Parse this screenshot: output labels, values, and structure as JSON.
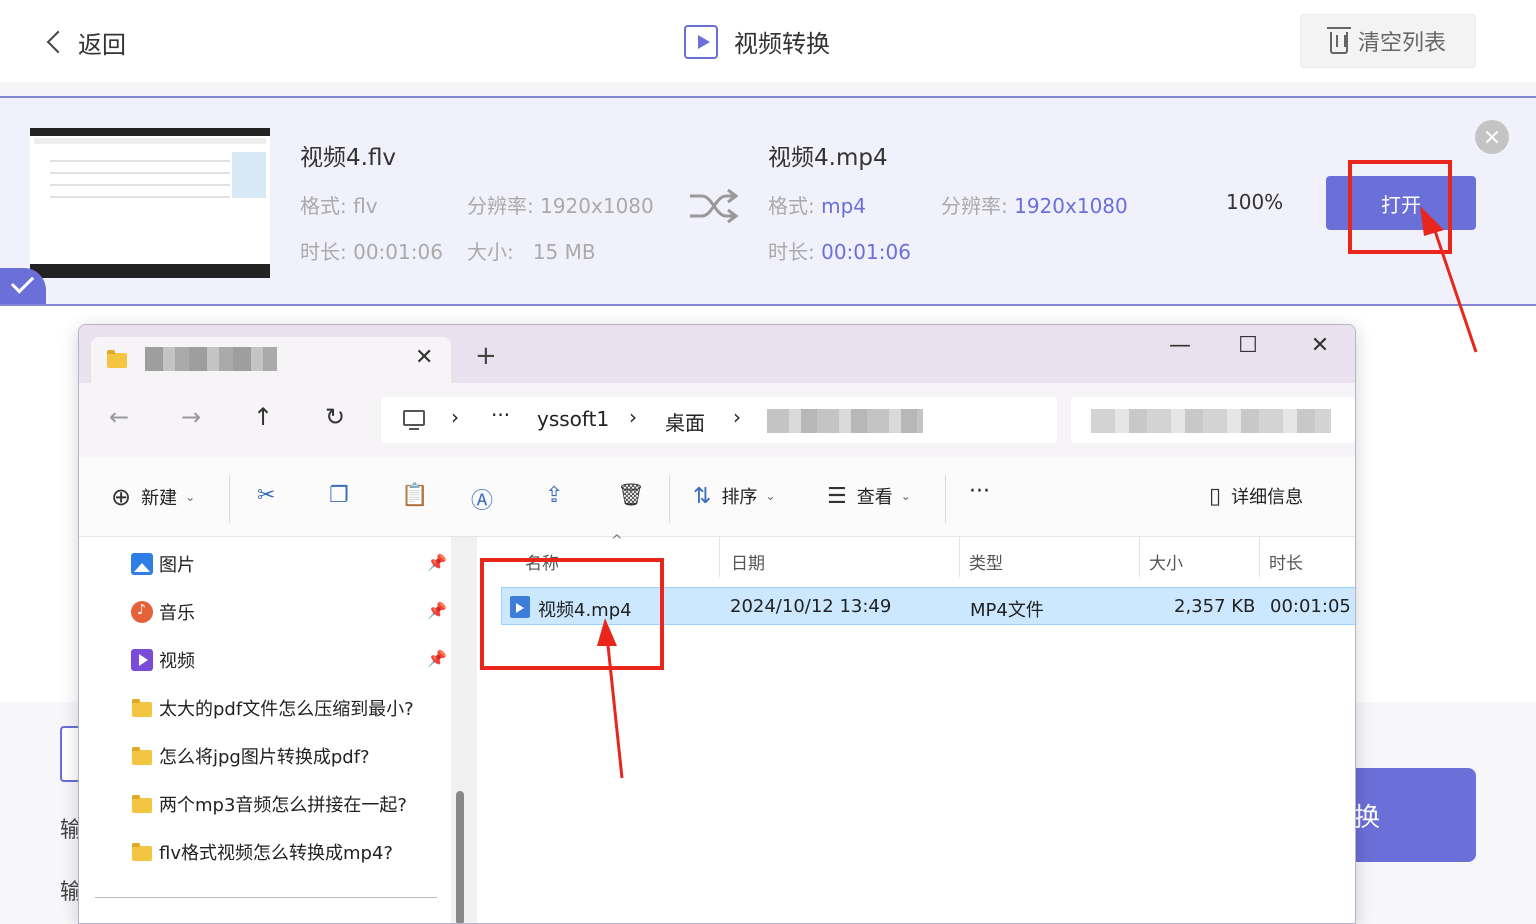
{
  "header": {
    "back_label": "返回",
    "title": "视频转换",
    "clear_label": "清空列表"
  },
  "file": {
    "source": {
      "name": "视频4.flv",
      "format_label": "格式:",
      "format": "flv",
      "resolution_label": "分辨率:",
      "resolution": "1920x1080",
      "duration_label": "时长:",
      "duration": "00:01:06",
      "size_label": "大小:",
      "size": "15 MB"
    },
    "target": {
      "name": "视频4.mp4",
      "format_label": "格式:",
      "format": "mp4",
      "resolution_label": "分辨率:",
      "resolution": "1920x1080",
      "duration_label": "时长:",
      "duration": "00:01:06"
    },
    "progress": "100%",
    "open_label": "打开"
  },
  "background": {
    "partial_label_1": "输",
    "partial_label_2": "输",
    "convert_partial": "换"
  },
  "explorer": {
    "tab_close": "✕",
    "tab_add": "+",
    "window_buttons": {
      "minimize": "—",
      "maximize": "☐",
      "close": "✕"
    },
    "breadcrumb": [
      "yssoft1",
      "桌面"
    ],
    "ellipsis": "···",
    "toolbar": {
      "new_label": "新建",
      "sort_label": "排序",
      "view_label": "查看",
      "more": "···",
      "details_label": "详细信息"
    },
    "nav_items": [
      {
        "label": "图片",
        "icon": "pictures-icon",
        "pinned": true
      },
      {
        "label": "音乐",
        "icon": "music-icon",
        "pinned": true
      },
      {
        "label": "视频",
        "icon": "videos-icon",
        "pinned": true
      },
      {
        "label": "太大的pdf文件怎么压缩到最小?",
        "icon": "folder-icon"
      },
      {
        "label": "怎么将jpg图片转换成pdf?",
        "icon": "folder-icon"
      },
      {
        "label": "两个mp3音频怎么拼接在一起?",
        "icon": "folder-icon"
      },
      {
        "label": "flv格式视频怎么转换成mp4?",
        "icon": "folder-icon"
      }
    ],
    "columns": [
      "名称",
      "日期",
      "类型",
      "大小",
      "时长"
    ],
    "rows": [
      {
        "name": "视频4.mp4",
        "date": "2024/10/12 13:49",
        "type": "MP4文件",
        "size": "2,357 KB",
        "duration": "00:01:05"
      }
    ]
  },
  "colors": {
    "accent": "#6b6fd8",
    "annotation": "#e8261c",
    "selection": "#cce8ff"
  }
}
